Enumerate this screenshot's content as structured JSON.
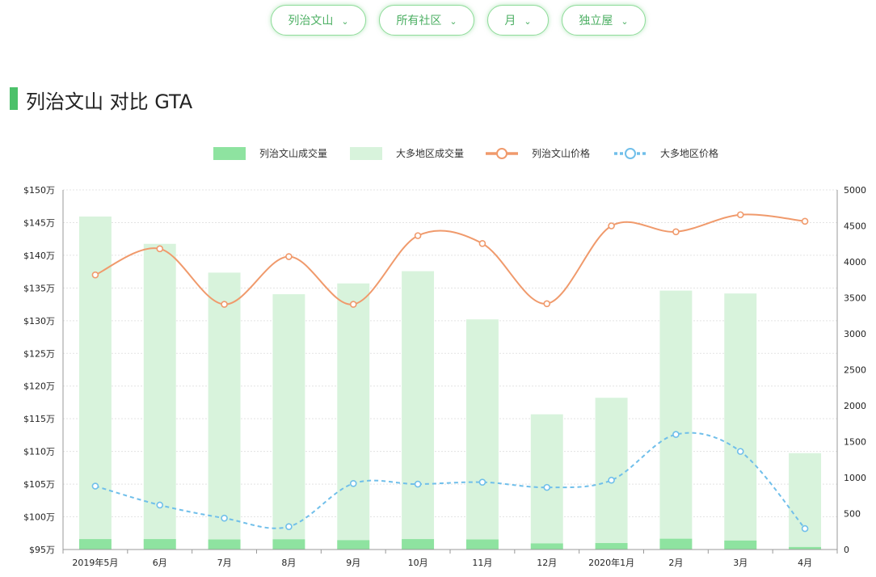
{
  "filters": [
    {
      "label": "列治文山"
    },
    {
      "label": "所有社区"
    },
    {
      "label": "月"
    },
    {
      "label": "独立屋"
    }
  ],
  "page_title": "列治文山 对比 GTA",
  "colors": {
    "local_volume": "#8ee3a0",
    "gta_volume": "#d8f3dc",
    "local_price": "#f09a6c",
    "gta_price": "#70bfea",
    "accent": "#4cc16a"
  },
  "chart_data": {
    "type": "bar",
    "categories": [
      "2019年5月",
      "6月",
      "7月",
      "8月",
      "9月",
      "10月",
      "11月",
      "12月",
      "2020年1月",
      "2月",
      "3月",
      "4月"
    ],
    "series": [
      {
        "name": "列治文山成交量",
        "type": "bar",
        "axis": "right",
        "values": [
          145,
          145,
          140,
          142,
          130,
          145,
          140,
          85,
          90,
          150,
          125,
          35
        ]
      },
      {
        "name": "大多地区成交量",
        "type": "bar",
        "axis": "right",
        "values": [
          4630,
          4250,
          3850,
          3550,
          3700,
          3870,
          3200,
          1880,
          2110,
          3600,
          3560,
          1340
        ]
      },
      {
        "name": "列治文山价格",
        "type": "line",
        "axis": "left",
        "values": [
          137.0,
          141.0,
          132.5,
          139.8,
          132.5,
          143.0,
          141.8,
          132.6,
          144.5,
          143.6,
          146.2,
          145.2
        ]
      },
      {
        "name": "大多地区价格",
        "type": "line",
        "axis": "left",
        "values": [
          104.7,
          101.8,
          99.8,
          98.5,
          105.1,
          105.0,
          105.3,
          104.5,
          105.6,
          112.6,
          110.0,
          98.2
        ]
      }
    ],
    "y_left": {
      "ylim": [
        95,
        150
      ],
      "ticks": [
        "$95万",
        "$100万",
        "$105万",
        "$110万",
        "$115万",
        "$120万",
        "$125万",
        "$130万",
        "$135万",
        "$140万",
        "$145万",
        "$150万"
      ]
    },
    "y_right": {
      "ylim": [
        0,
        5000
      ],
      "ticks": [
        "0",
        "500",
        "1000",
        "1500",
        "2000",
        "2500",
        "3000",
        "3500",
        "4000",
        "4500",
        "5000"
      ]
    },
    "legend_position": "top-center",
    "grid": true
  }
}
